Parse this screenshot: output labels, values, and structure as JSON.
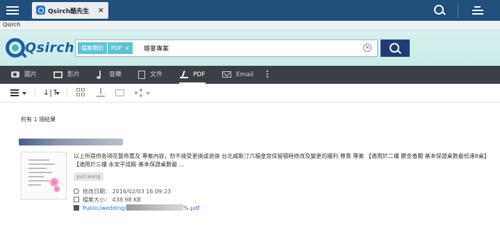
{
  "os_bar": {
    "tab_title": "Qsirch酷先生",
    "tab_close": "×"
  },
  "window": {
    "title": "Qsirch"
  },
  "brand": {
    "wordmark": "Qsirch"
  },
  "search": {
    "tag_type": "檔案類別",
    "tag_value": "PDF",
    "tag_remove": "×",
    "query": "婚宴專案",
    "clear": "✕"
  },
  "categories": [
    {
      "label": "圖片",
      "icon": "camera-icon"
    },
    {
      "label": "影片",
      "icon": "film-icon"
    },
    {
      "label": "音樂",
      "icon": "music-icon"
    },
    {
      "label": "文件",
      "icon": "document-icon"
    },
    {
      "label": "PDF",
      "icon": "pdf-icon",
      "active": true
    },
    {
      "label": "Email",
      "icon": "mail-icon"
    }
  ],
  "toolbar": {
    "sort_symbol": "↓|↑"
  },
  "results": {
    "count": "約有 1 項結果",
    "items": [
      {
        "snippet": "以上所提供各項花藝佈置及 專案內容，恕不接受更換或退換 台北威斯汀六福皇宮保留隨時修改及變更的權利 尊貴 專案 【適用於二樓 鬱金香閣 基本保證桌數最低達8桌】 【適用於三樓 永安平成殿 基本保證桌數最 ...",
        "owner": "yuri.wang",
        "modified_label": "修改日期：",
        "modified_value": "2016/02/03 16:09:23",
        "size_label": "檔案大小：",
        "size_value": "438.98 KB",
        "path_prefix": "Public/wedding/",
        "path_suffix": "%.pdf"
      }
    ]
  },
  "colors": {
    "os_bar": "#1f4f7a",
    "brand_blue": "#1f5d9b",
    "search_button": "#1f3d73",
    "tag": "#5fc3d2",
    "category_bar": "#3b4046",
    "link": "#2a6fd6"
  }
}
